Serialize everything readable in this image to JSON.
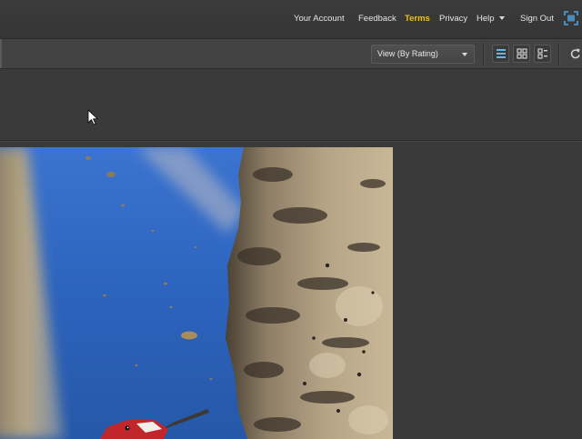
{
  "nav": {
    "items": [
      {
        "label": "Your Account",
        "active": false
      },
      {
        "label": "Feedback",
        "active": false
      },
      {
        "label": "Terms",
        "active": true
      },
      {
        "label": "Privacy",
        "active": false
      },
      {
        "label": "Help",
        "active": false,
        "has_menu": true
      },
      {
        "label": "Sign Out",
        "active": false
      }
    ],
    "active_color": "#f0c020",
    "fullscreen_icon": "fullscreen-icon"
  },
  "toolbar": {
    "view_select": {
      "value": "View (By Rating)"
    },
    "view_modes": [
      "list-view-icon",
      "grid-view-icon",
      "detail-view-icon"
    ],
    "active_view_color": "#6fb3d6",
    "refresh_icon": "refresh-icon"
  },
  "photo": {
    "subject": "woodpecker-on-tree-trunk",
    "sky_color": "#2f67c2",
    "bark_color": "#b19c7d"
  }
}
